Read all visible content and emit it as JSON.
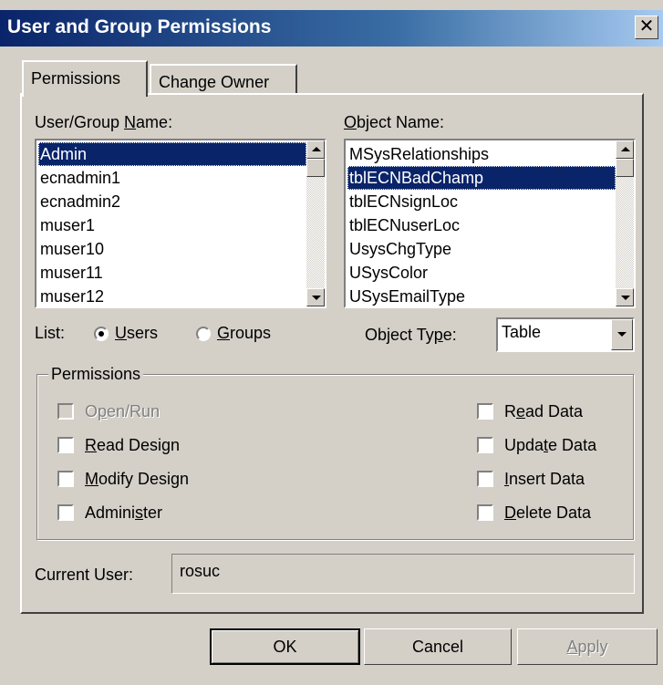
{
  "window": {
    "title": "User and Group Permissions",
    "close_glyph": "✕"
  },
  "tabs": [
    {
      "label": "Permissions",
      "active": true
    },
    {
      "label": "Change Owner",
      "active": false
    }
  ],
  "user_group": {
    "label_pre": "User/Group ",
    "label_u": "N",
    "label_post": "ame:",
    "items": [
      "Admin",
      "ecnadmin1",
      "ecnadmin2",
      "muser1",
      "muser10",
      "muser11",
      "muser12"
    ],
    "selected": "Admin"
  },
  "object": {
    "label_u": "O",
    "label_post": "bject Name:",
    "items": [
      "MSysRelationships",
      "tblECNBadChamp",
      "tblECNsignLoc",
      "tblECNuserLoc",
      "UsysChgType",
      "USysColor",
      "USysEmailType"
    ],
    "selected": "tblECNBadChamp"
  },
  "list": {
    "label": "List:",
    "users": {
      "pre": "",
      "u": "U",
      "post": "sers",
      "checked": true
    },
    "groups": {
      "pre": "",
      "u": "G",
      "post": "roups",
      "checked": false
    }
  },
  "object_type": {
    "label_pre": "Object Ty",
    "label_u": "p",
    "label_post": "e:",
    "value": "Table"
  },
  "permissions": {
    "legend": "Permissions",
    "open_run": {
      "pre": "O",
      "u": "p",
      "post": "en/Run",
      "disabled": true
    },
    "read_design": {
      "pre": "",
      "u": "R",
      "post": "ead Design"
    },
    "modify_design": {
      "pre": "",
      "u": "M",
      "post": "odify Design"
    },
    "administer": {
      "pre": "Admini",
      "u": "s",
      "post": "ter"
    },
    "read_data": {
      "pre": "R",
      "u": "e",
      "post": "ad Data"
    },
    "update_data": {
      "pre": "Upda",
      "u": "t",
      "post": "e Data"
    },
    "insert_data": {
      "pre": "",
      "u": "I",
      "post": "nsert Data"
    },
    "delete_data": {
      "pre": "",
      "u": "D",
      "post": "elete Data"
    }
  },
  "current_user": {
    "label": "Current User:",
    "value": "rosuc"
  },
  "buttons": {
    "ok": "OK",
    "cancel": "Cancel",
    "apply_u": "A",
    "apply_post": "pply"
  },
  "colors": {
    "face": "#d4d0c8",
    "title_start": "#0a246a",
    "title_end": "#a6caf0",
    "selection": "#0a246a"
  }
}
